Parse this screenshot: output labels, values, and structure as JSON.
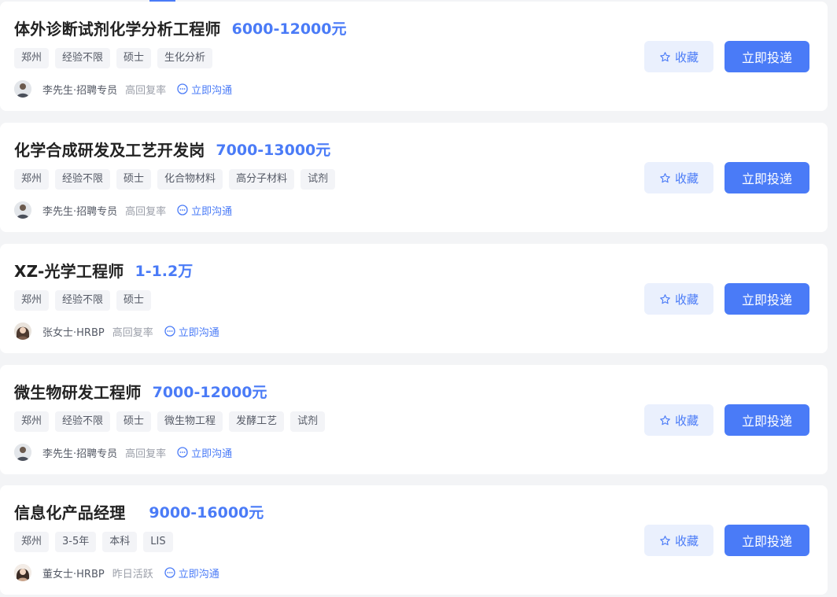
{
  "colors": {
    "accent": "#4a7bf7",
    "background": "#f3f4f6",
    "card": "#ffffff",
    "tag_bg": "#f3f4f7"
  },
  "jobs": [
    {
      "title": "体外诊断试剂化学分析工程师",
      "salary": "6000-12000元",
      "tags": [
        "郑州",
        "经验不限",
        "硕士",
        "生化分析"
      ],
      "recruiter": {
        "name": "李先生·招聘专员",
        "activity": "高回复率",
        "avatar_icon": "male-avatar-icon"
      },
      "chat_label": "立即沟通",
      "favorite_label": "收藏",
      "apply_label": "立即投递"
    },
    {
      "title": "化学合成研发及工艺开发岗",
      "salary": "7000-13000元",
      "tags": [
        "郑州",
        "经验不限",
        "硕士",
        "化合物材料",
        "高分子材料",
        "试剂"
      ],
      "recruiter": {
        "name": "李先生·招聘专员",
        "activity": "高回复率",
        "avatar_icon": "male-avatar-icon"
      },
      "chat_label": "立即沟通",
      "favorite_label": "收藏",
      "apply_label": "立即投递"
    },
    {
      "title": "XZ-光学工程师",
      "salary": "1-1.2万",
      "tags": [
        "郑州",
        "经验不限",
        "硕士"
      ],
      "recruiter": {
        "name": "张女士·HRBP",
        "activity": "高回复率",
        "avatar_icon": "female-avatar-icon"
      },
      "chat_label": "立即沟通",
      "favorite_label": "收藏",
      "apply_label": "立即投递"
    },
    {
      "title": "微生物研发工程师",
      "salary": "7000-12000元",
      "tags": [
        "郑州",
        "经验不限",
        "硕士",
        "微生物工程",
        "发酵工艺",
        "试剂"
      ],
      "recruiter": {
        "name": "李先生·招聘专员",
        "activity": "高回复率",
        "avatar_icon": "male-avatar-icon"
      },
      "chat_label": "立即沟通",
      "favorite_label": "收藏",
      "apply_label": "立即投递"
    },
    {
      "title": "信息化产品经理",
      "salary": "9000-16000元",
      "tags": [
        "郑州",
        "3-5年",
        "本科",
        "LIS"
      ],
      "recruiter": {
        "name": "董女士·HRBP",
        "activity": "昨日活跃",
        "avatar_icon": "female-avatar-icon"
      },
      "chat_label": "立即沟通",
      "favorite_label": "收藏",
      "apply_label": "立即投递"
    }
  ]
}
